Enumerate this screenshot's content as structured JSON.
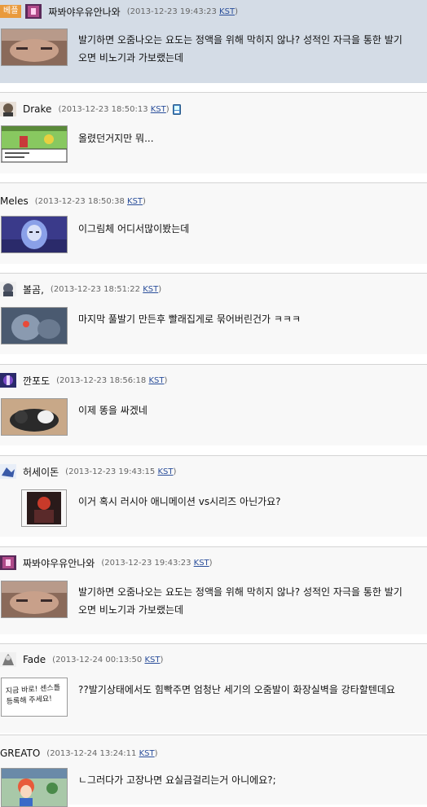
{
  "best_label": "베플",
  "comments": [
    {
      "nick": "짜봐야우유안나와",
      "date": "2013-12-23 19:43:23",
      "tz": "KST",
      "lines": [
        "발기하면 오줌나오는 요도는 정액을 위해 막히지 않나? 성적인 자극을 통한 발기",
        "오면 비노기과 가보랬는데"
      ]
    },
    {
      "nick": "Drake",
      "date": "2013-12-23 18:50:13",
      "tz": "KST",
      "lines": [
        "올렸던거지만 뭐..."
      ]
    },
    {
      "nick": "Meles",
      "date": "2013-12-23 18:50:38",
      "tz": "KST",
      "lines": [
        "이그림체 어디서많이봤는데"
      ]
    },
    {
      "nick": "볼곰,",
      "date": "2013-12-23 18:51:22",
      "tz": "KST",
      "lines": [
        "마지막 풀발기 만든후 빨래집게로 묶어버린건가 ㅋㅋㅋ"
      ]
    },
    {
      "nick": "깐포도",
      "date": "2013-12-23 18:56:18",
      "tz": "KST",
      "lines": [
        "이제 똥을 싸겠네"
      ]
    },
    {
      "nick": "허세이돈",
      "date": "2013-12-23 19:43:15",
      "tz": "KST",
      "lines": [
        "이거 혹시 러시아 애니메이션 vs시리즈 아닌가요?"
      ]
    },
    {
      "nick": "짜봐야우유안나와",
      "date": "2013-12-23 19:43:23",
      "tz": "KST",
      "lines": [
        "발기하면 오줌나오는 요도는 정액을 위해 막히지 않나? 성적인 자극을 통한 발기",
        "오면 비노기과 가보랬는데"
      ]
    },
    {
      "nick": "Fade",
      "date": "2013-12-24 00:13:50",
      "tz": "KST",
      "lines": [
        "??발기상태에서도 힘빡주면 엄청난 세기의 오줌발이 화장실벽을 강타할텐데요"
      ],
      "thumb_text": [
        "지금 바로! 센스를",
        "등록해 주세요!"
      ]
    },
    {
      "nick": "GREATO",
      "date": "2013-12-24 13:24:11",
      "tz": "KST",
      "lines": [
        "ㄴ그러다가 고장나면 요실금걸리는거 아니에요?;"
      ]
    }
  ],
  "colors": {
    "best_bg": "#d4dce6",
    "best_badge": "#e99a3c",
    "link": "#2a4e9a"
  }
}
